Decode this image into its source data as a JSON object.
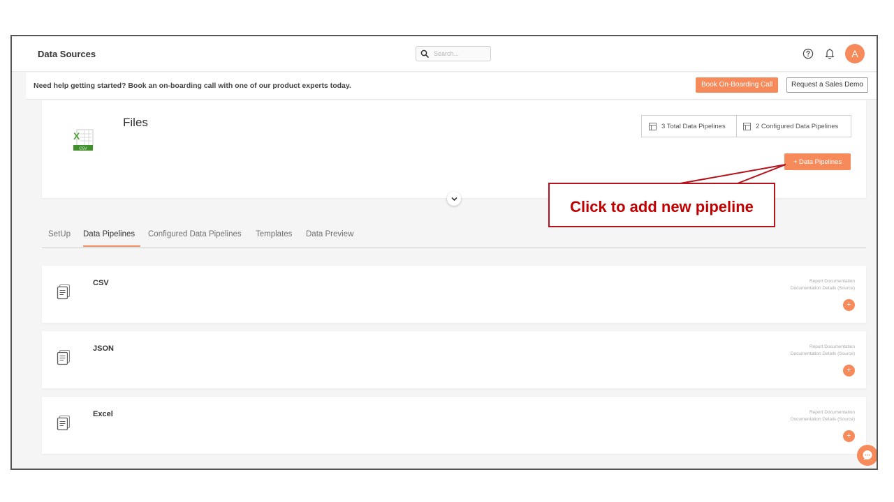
{
  "header": {
    "title": "Data Sources",
    "search_placeholder": "Search...",
    "avatar_letter": "A"
  },
  "banner": {
    "text": "Need help getting started? Book an on-boarding call with one of our product experts today.",
    "book_label": "Book On-Boarding Call",
    "demo_label": "Request a Sales Demo"
  },
  "source": {
    "title": "Files",
    "logo_text": "CSV",
    "total_pipelines": "3 Total Data Pipelines",
    "configured_pipelines": "2 Configured Data Pipelines",
    "add_pipeline_label": "+ Data Pipelines"
  },
  "annotation": {
    "text": "Click to add new pipeline"
  },
  "tabs": [
    {
      "label": "SetUp",
      "active": false
    },
    {
      "label": "Data Pipelines",
      "active": true
    },
    {
      "label": "Configured Data Pipelines",
      "active": false
    },
    {
      "label": "Templates",
      "active": false
    },
    {
      "label": "Data Preview",
      "active": false
    }
  ],
  "pipelines": [
    {
      "name": "CSV",
      "doc1": "Report Documentation",
      "doc2": "Documentation Details (Source)",
      "add": "+"
    },
    {
      "name": "JSON",
      "doc1": "Report Documentation",
      "doc2": "Documentation Details (Source)",
      "add": "+"
    },
    {
      "name": "Excel",
      "doc1": "Report Documentation",
      "doc2": "Documentation Details (Source)",
      "add": "+"
    }
  ],
  "colors": {
    "accent": "#f68a5a",
    "annotation": "#c00000"
  }
}
